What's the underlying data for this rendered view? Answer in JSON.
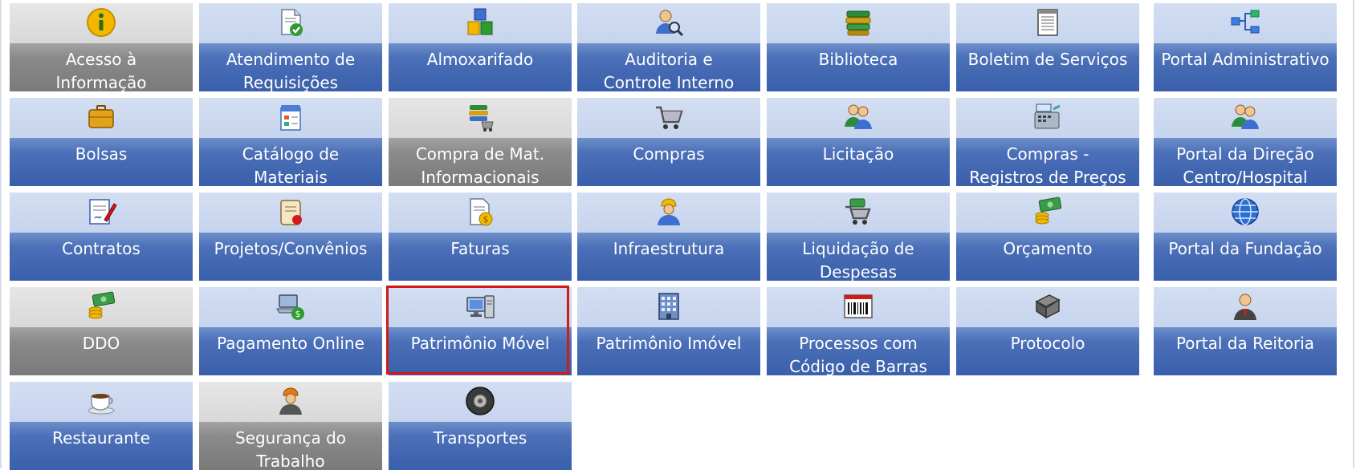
{
  "colors": {
    "tile_top_blue": "#c6d4ee",
    "tile_bottom_blue": "#4b70b8",
    "tile_top_gray": "#d8d8d8",
    "tile_bottom_gray": "#8a8a8a",
    "selection_border": "#d11b1b",
    "label_text": "#ffffff"
  },
  "modules": [
    {
      "label": "Acesso à\nInformação",
      "icon": "info-icon",
      "disabled": true
    },
    {
      "label": "Atendimento de\nRequisições",
      "icon": "document-check-icon",
      "disabled": false
    },
    {
      "label": "Almoxarifado",
      "icon": "boxes-icon",
      "disabled": false
    },
    {
      "label": "Auditoria e\nControle Interno",
      "icon": "user-search-icon",
      "disabled": false
    },
    {
      "label": "Biblioteca",
      "icon": "books-icon",
      "disabled": false
    },
    {
      "label": "Boletim de Serviços",
      "icon": "document-list-icon",
      "disabled": false
    },
    {
      "label": "Portal Administrativo",
      "icon": "network-icon",
      "disabled": false
    },
    {
      "label": "Bolsas",
      "icon": "briefcase-icon",
      "disabled": false
    },
    {
      "label": "Catálogo de\nMateriais",
      "icon": "catalog-icon",
      "disabled": false
    },
    {
      "label": "Compra de Mat.\nInformacionais",
      "icon": "books-cart-icon",
      "disabled": true
    },
    {
      "label": "Compras",
      "icon": "shopping-cart-icon",
      "disabled": false
    },
    {
      "label": "Licitação",
      "icon": "people-icon",
      "disabled": false
    },
    {
      "label": "Compras -\nRegistros de Preços",
      "icon": "cash-register-icon",
      "disabled": false
    },
    {
      "label": "Portal da Direção\nCentro/Hospital",
      "icon": "people-icon",
      "disabled": false
    },
    {
      "label": "Contratos",
      "icon": "contract-pen-icon",
      "disabled": false
    },
    {
      "label": "Projetos/Convênios",
      "icon": "scroll-icon",
      "disabled": false
    },
    {
      "label": "Faturas",
      "icon": "invoice-coin-icon",
      "disabled": false
    },
    {
      "label": "Infraestrutura",
      "icon": "worker-icon",
      "disabled": false
    },
    {
      "label": "Liquidação de\nDespesas",
      "icon": "cart-money-icon",
      "disabled": false
    },
    {
      "label": "Orçamento",
      "icon": "money-coins-icon",
      "disabled": false
    },
    {
      "label": "Portal da Fundação",
      "icon": "globe-icon",
      "disabled": false
    },
    {
      "label": "DDO",
      "icon": "money-coins-icon",
      "disabled": true
    },
    {
      "label": "Pagamento Online",
      "icon": "laptop-payment-icon",
      "disabled": false
    },
    {
      "label": "Patrimônio Móvel",
      "icon": "computer-icon",
      "disabled": false,
      "selected": true
    },
    {
      "label": "Patrimônio Imóvel",
      "icon": "building-icon",
      "disabled": false
    },
    {
      "label": "Processos com\nCódigo de Barras",
      "icon": "barcode-icon",
      "disabled": false
    },
    {
      "label": "Protocolo",
      "icon": "book-icon",
      "disabled": false
    },
    {
      "label": "Portal da Reitoria",
      "icon": "person-icon",
      "disabled": false
    },
    {
      "label": "Restaurante",
      "icon": "cup-icon",
      "disabled": false
    },
    {
      "label": "Segurança do\nTrabalho",
      "icon": "hardhat-worker-icon",
      "disabled": true
    },
    {
      "label": "Transportes",
      "icon": "tire-icon",
      "disabled": false
    }
  ]
}
